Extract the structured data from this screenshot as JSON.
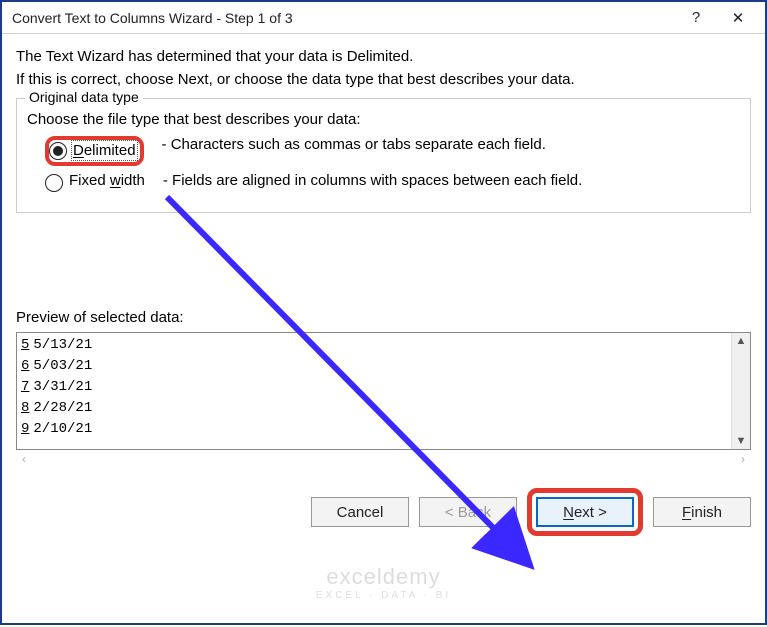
{
  "titlebar": {
    "title": "Convert Text to Columns Wizard - Step 1 of 3",
    "help": "?",
    "close": "✕"
  },
  "intro": {
    "line1": "The Text Wizard has determined that your data is Delimited.",
    "line2": "If this is correct, choose Next, or choose the data type that best describes your data."
  },
  "fieldset": {
    "legend": "Original data type",
    "choose": "Choose the file type that best describes your data:",
    "radios": [
      {
        "value": "delimited",
        "label_u": "D",
        "label_rest": "elimited",
        "selected": true,
        "desc": "- Characters such as commas or tabs separate each field."
      },
      {
        "value": "fixed",
        "label_pre": "Fixed ",
        "label_u": "w",
        "label_rest": "idth",
        "selected": false,
        "desc": "- Fields are aligned in columns with spaces between each field."
      }
    ]
  },
  "preview": {
    "label": "Preview of selected data:",
    "rows": [
      {
        "num": "5",
        "text": "5/13/21"
      },
      {
        "num": "6",
        "text": "5/03/21"
      },
      {
        "num": "7",
        "text": "3/31/21"
      },
      {
        "num": "8",
        "text": "2/28/21"
      },
      {
        "num": "9",
        "text": "2/10/21"
      }
    ]
  },
  "buttons": {
    "cancel": "Cancel",
    "back": "< Back",
    "next_u": "N",
    "next_rest": "ext >",
    "finish_u": "F",
    "finish_rest": "inish"
  },
  "watermark": {
    "line1": "exceldemy",
    "line2": "EXCEL · DATA · BI"
  },
  "annotation": {
    "highlight_color": "#e23a2e",
    "arrow_color": "#3b27ff"
  }
}
